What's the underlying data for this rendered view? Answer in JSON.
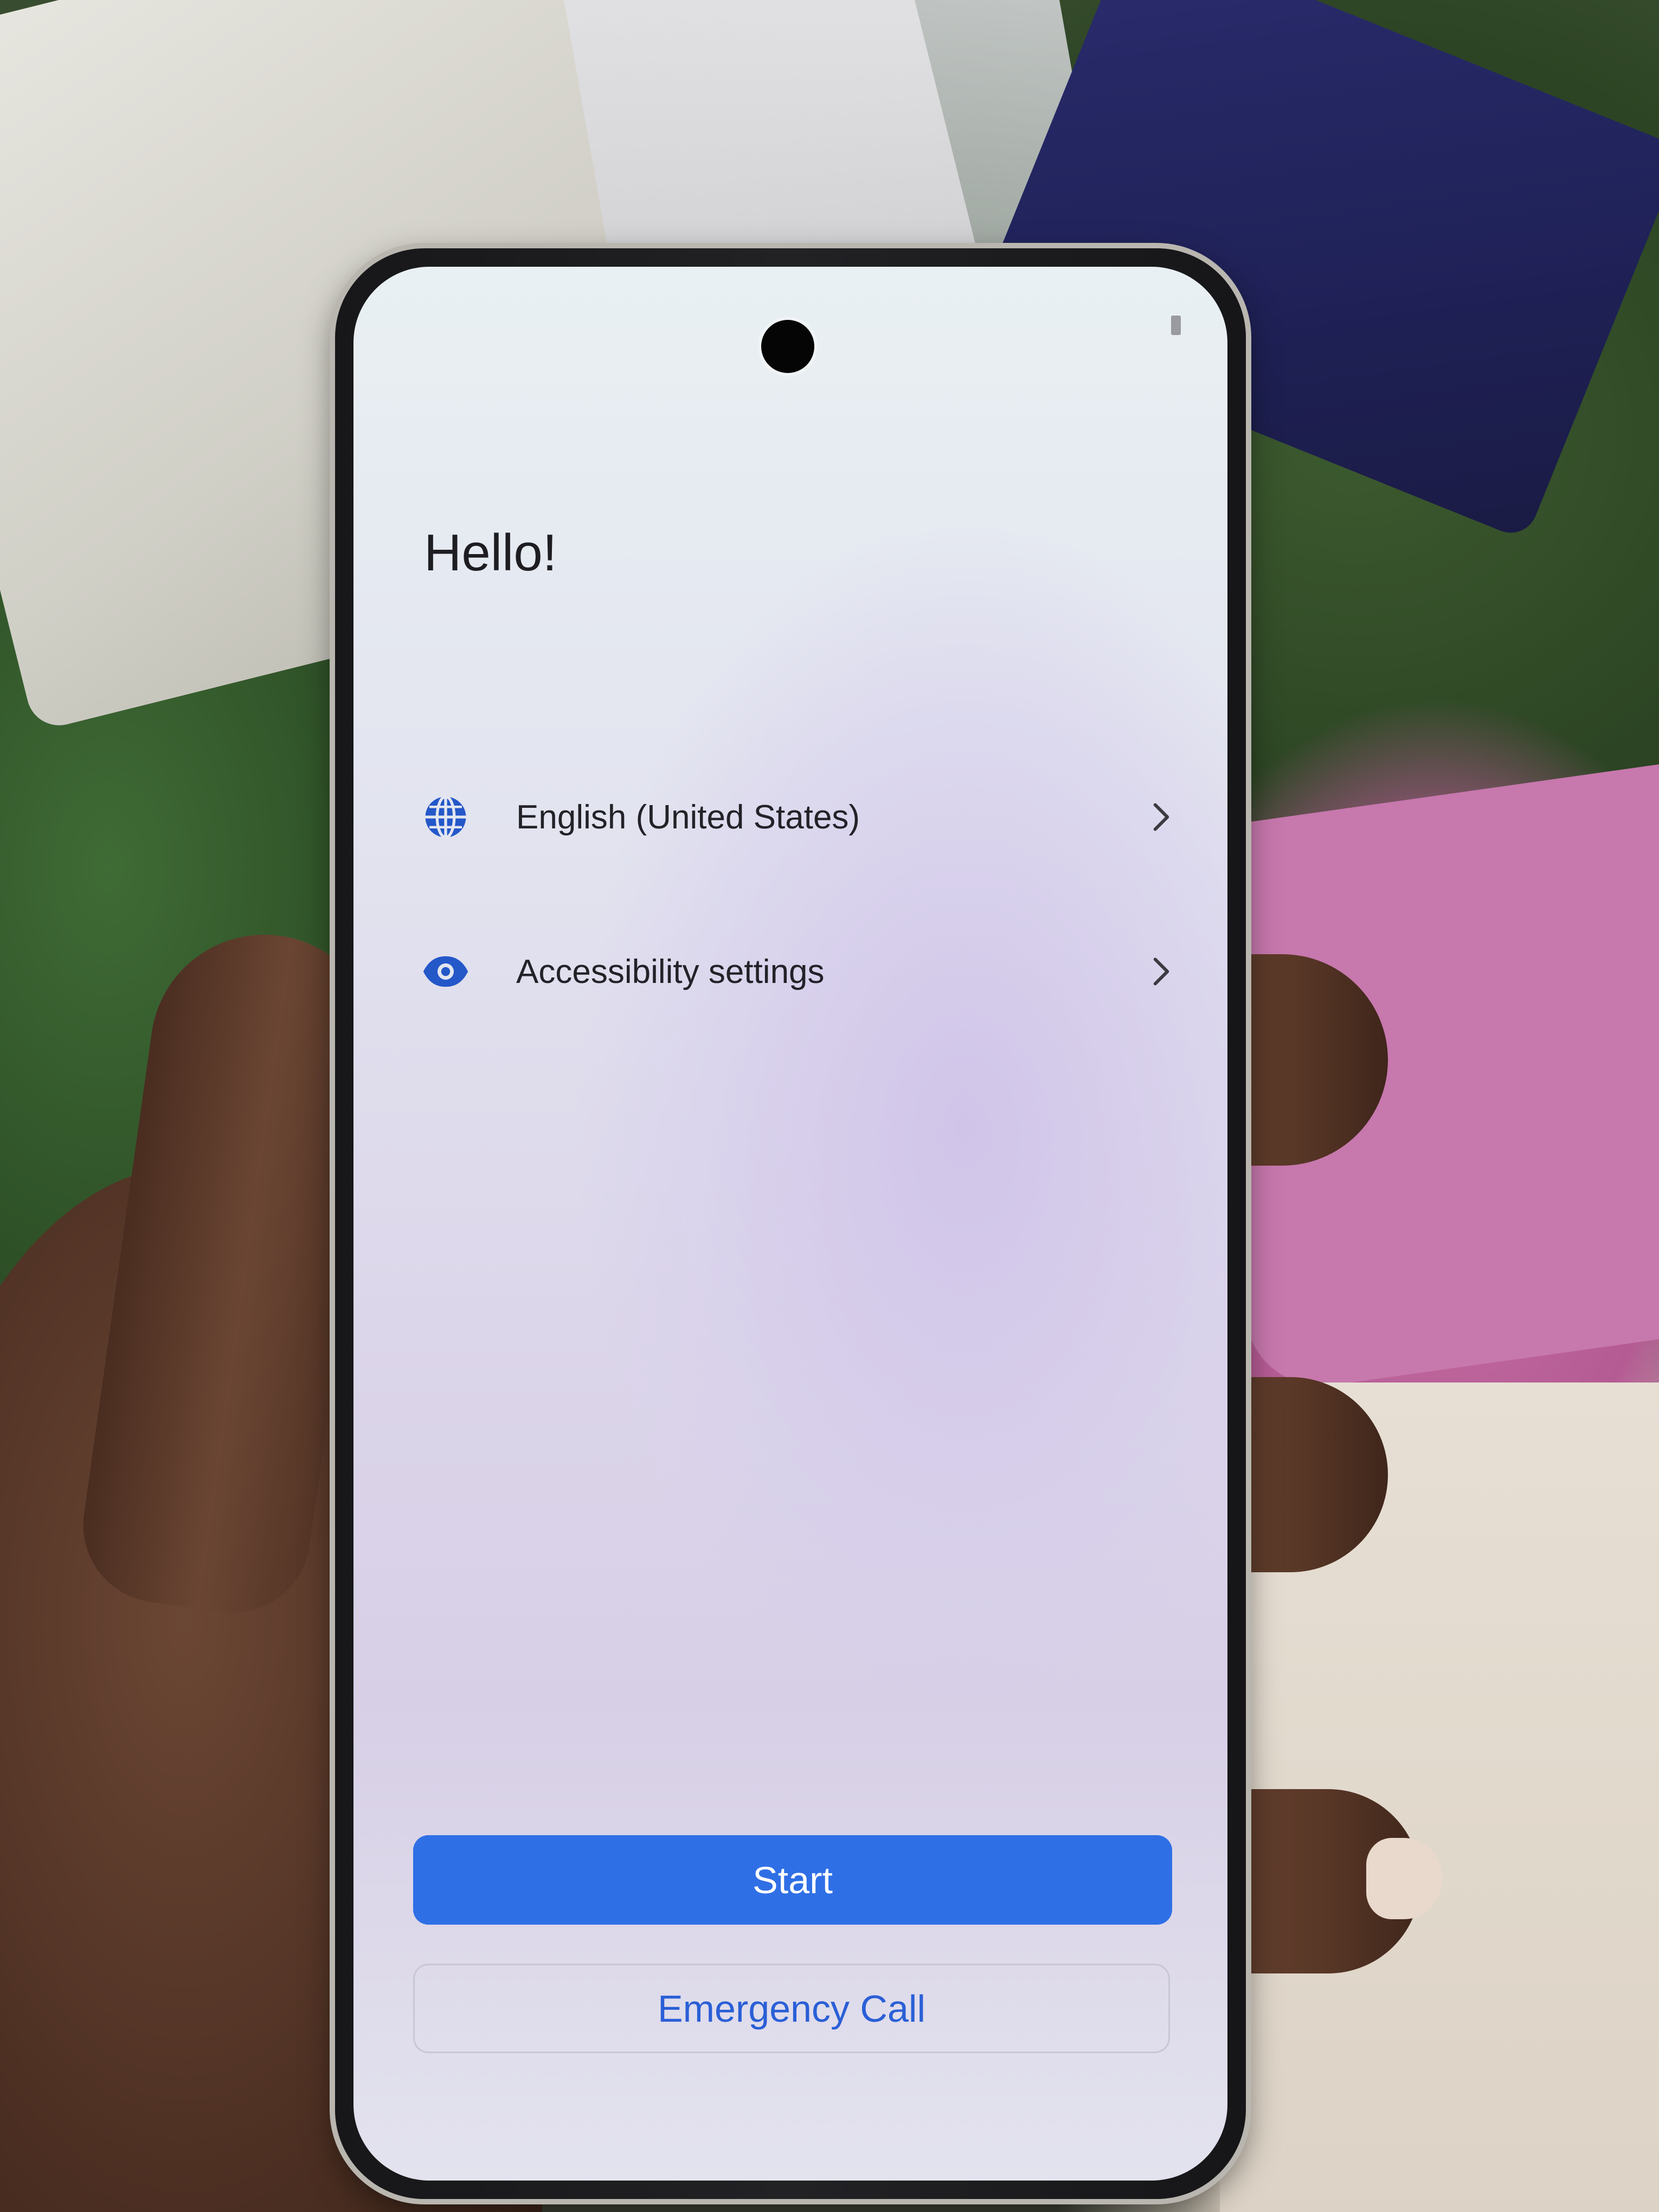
{
  "screen": {
    "title": "Hello!"
  },
  "options": [
    {
      "icon": "globe-icon",
      "label": "English (United States)"
    },
    {
      "icon": "eye-icon",
      "label": "Accessibility settings"
    }
  ],
  "actions": {
    "start_label": "Start",
    "emergency_label": "Emergency Call"
  },
  "colors": {
    "accent": "#2f6fe6",
    "icon_blue": "#2458c9",
    "text_dark": "#1d1d22",
    "link_blue": "#2a5fd6"
  }
}
